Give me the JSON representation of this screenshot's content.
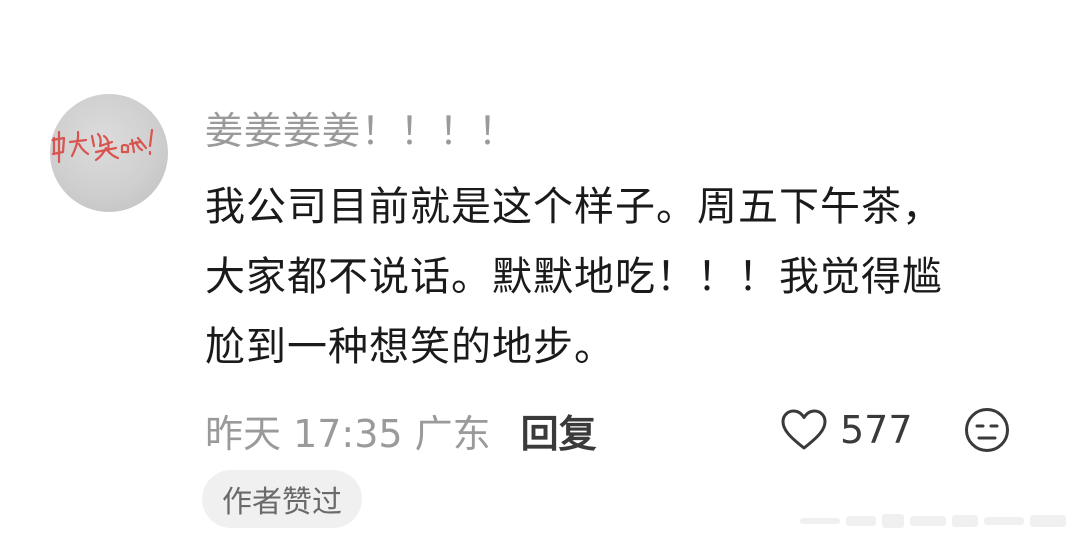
{
  "comment": {
    "username": "姜姜姜姜！！！！",
    "avatar_icon": "handwriting-avatar-icon",
    "avatar_text": "中大奖啦！",
    "body_lines": [
      "我公司目前就是这个样子。周五下午茶，",
      "大家都不说话。默默地吃！！！我觉得尴",
      "尬到一种想笑的地步。"
    ],
    "time": "昨天 17:35",
    "location": "广东",
    "reply_label": "回复",
    "like_icon": "heart-outline-icon",
    "like_count": "577",
    "dislike_icon": "neutral-face-icon",
    "author_liked_badge": "作者赞过"
  },
  "colors": {
    "muted_text": "#9a9a9a",
    "body_text": "#1a1a1a",
    "badge_bg": "#f0f0f0",
    "avatar_ink": "#d9534f"
  }
}
